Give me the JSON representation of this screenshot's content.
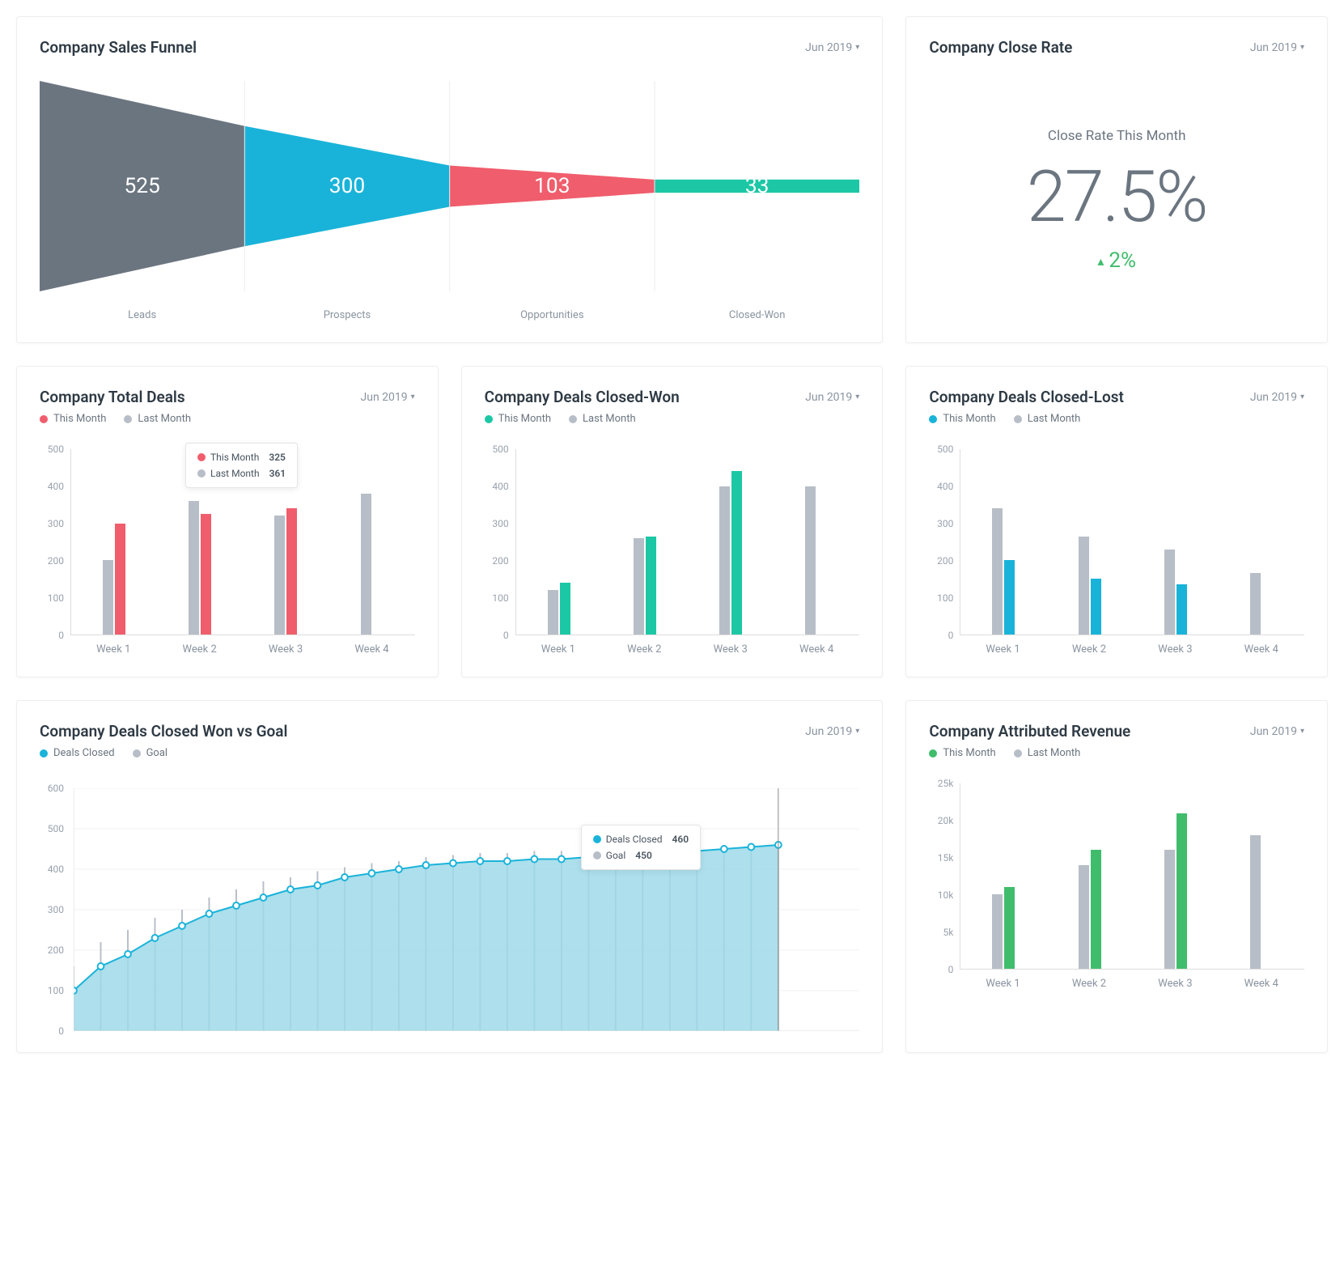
{
  "colors": {
    "slate": "#6b7580",
    "cyan": "#19b3d9",
    "coral": "#f05d6c",
    "teal": "#1cc7a5",
    "grayBar": "#b7bec7",
    "green": "#40bd6c",
    "areaFill": "#9fd9e9"
  },
  "funnel": {
    "title": "Company Sales Funnel",
    "date": "Jun 2019"
  },
  "close_rate": {
    "title": "Company Close Rate",
    "date": "Jun 2019",
    "label": "Close Rate This Month",
    "value": "27.5%",
    "delta": "2%"
  },
  "total_deals": {
    "title": "Company Total Deals",
    "date": "Jun 2019",
    "legend_a": "This Month",
    "legend_b": "Last Month",
    "tooltip_a_label": "This Month",
    "tooltip_a_val": "325",
    "tooltip_b_label": "Last Month",
    "tooltip_b_val": "361"
  },
  "closed_won": {
    "title": "Company Deals Closed-Won",
    "date": "Jun 2019",
    "legend_a": "This Month",
    "legend_b": "Last Month"
  },
  "closed_lost": {
    "title": "Company Deals Closed-Lost",
    "date": "Jun 2019",
    "legend_a": "This Month",
    "legend_b": "Last Month"
  },
  "won_vs_goal": {
    "title": "Company Deals Closed Won vs Goal",
    "date": "Jun 2019",
    "legend_a": "Deals Closed",
    "legend_b": "Goal",
    "tooltip_a_label": "Deals Closed",
    "tooltip_a_val": "460",
    "tooltip_b_label": "Goal",
    "tooltip_b_val": "450"
  },
  "revenue": {
    "title": "Company Attributed Revenue",
    "date": "Jun 2019",
    "legend_a": "This Month",
    "legend_b": "Last Month"
  },
  "chart_data": [
    {
      "id": "funnel",
      "type": "funnel",
      "title": "Company Sales Funnel",
      "categories": [
        "Leads",
        "Prospects",
        "Opportunities",
        "Closed-Won"
      ],
      "values": [
        525,
        300,
        103,
        33
      ],
      "colors": [
        "#6b7580",
        "#19b3d9",
        "#f05d6c",
        "#1cc7a5"
      ]
    },
    {
      "id": "close_rate",
      "type": "kpi",
      "title": "Company Close Rate",
      "label": "Close Rate This Month",
      "value": 27.5,
      "unit": "%",
      "delta": 2,
      "delta_direction": "up"
    },
    {
      "id": "total_deals",
      "type": "bar",
      "title": "Company Total Deals",
      "categories": [
        "Week 1",
        "Week 2",
        "Week 3",
        "Week 4"
      ],
      "series": [
        {
          "name": "Last Month",
          "color": "#b7bec7",
          "values": [
            200,
            361,
            320,
            380
          ]
        },
        {
          "name": "This Month",
          "color": "#f05d6c",
          "values": [
            300,
            325,
            340,
            null
          ]
        }
      ],
      "ylim": [
        0,
        500
      ],
      "yticks": [
        0,
        100,
        200,
        300,
        400,
        500
      ],
      "highlight": {
        "category": "Week 2",
        "This Month": 325,
        "Last Month": 361
      }
    },
    {
      "id": "closed_won",
      "type": "bar",
      "title": "Company Deals Closed-Won",
      "categories": [
        "Week 1",
        "Week 2",
        "Week 3",
        "Week 4"
      ],
      "series": [
        {
          "name": "Last Month",
          "color": "#b7bec7",
          "values": [
            120,
            260,
            400,
            400
          ]
        },
        {
          "name": "This Month",
          "color": "#1cc7a5",
          "values": [
            140,
            265,
            440,
            null
          ]
        }
      ],
      "ylim": [
        0,
        500
      ],
      "yticks": [
        0,
        100,
        200,
        300,
        400,
        500
      ]
    },
    {
      "id": "closed_lost",
      "type": "bar",
      "title": "Company Deals Closed-Lost",
      "categories": [
        "Week 1",
        "Week 2",
        "Week 3",
        "Week 4"
      ],
      "series": [
        {
          "name": "Last Month",
          "color": "#b7bec7",
          "values": [
            340,
            265,
            230,
            165
          ]
        },
        {
          "name": "This Month",
          "color": "#19b3d9",
          "values": [
            200,
            150,
            135,
            null
          ]
        }
      ],
      "ylim": [
        0,
        500
      ],
      "yticks": [
        0,
        100,
        200,
        300,
        400,
        500
      ]
    },
    {
      "id": "won_vs_goal",
      "type": "area",
      "title": "Company Deals Closed Won vs Goal",
      "x": [
        1,
        2,
        3,
        4,
        5,
        6,
        7,
        8,
        9,
        10,
        11,
        12,
        13,
        14,
        15,
        16,
        17,
        18,
        19,
        20,
        21,
        22,
        23,
        24,
        25,
        26,
        27,
        28,
        29,
        30
      ],
      "series": [
        {
          "name": "Deals Closed",
          "color": "#19b3d9",
          "values": [
            100,
            160,
            190,
            230,
            260,
            290,
            310,
            330,
            350,
            360,
            380,
            390,
            400,
            410,
            415,
            420,
            420,
            425,
            425,
            430,
            430,
            435,
            440,
            445,
            450,
            455,
            460,
            null,
            null,
            null
          ]
        },
        {
          "name": "Goal",
          "color": "#b7bec7",
          "goal_line": true,
          "values": [
            160,
            220,
            250,
            280,
            300,
            330,
            350,
            370,
            380,
            395,
            405,
            415,
            420,
            430,
            435,
            440,
            440,
            445,
            445,
            445,
            445,
            448,
            448,
            450,
            450,
            450,
            450,
            null,
            null,
            null
          ]
        }
      ],
      "ylim": [
        0,
        600
      ],
      "yticks": [
        0,
        100,
        200,
        300,
        400,
        500,
        600
      ],
      "highlight": {
        "x": 27,
        "Deals Closed": 460,
        "Goal": 450
      }
    },
    {
      "id": "revenue",
      "type": "bar",
      "title": "Company Attributed Revenue",
      "categories": [
        "Week 1",
        "Week 2",
        "Week 3",
        "Week 4"
      ],
      "series": [
        {
          "name": "Last Month",
          "color": "#b7bec7",
          "values": [
            10000,
            14000,
            16000,
            18000
          ]
        },
        {
          "name": "This Month",
          "color": "#40bd6c",
          "values": [
            11000,
            16000,
            21000,
            null
          ]
        }
      ],
      "ylim": [
        0,
        25000
      ],
      "yticks": [
        0,
        5000,
        10000,
        15000,
        20000,
        25000
      ],
      "ytick_labels": [
        "0",
        "5k",
        "10k",
        "15k",
        "20k",
        "25k"
      ]
    }
  ]
}
